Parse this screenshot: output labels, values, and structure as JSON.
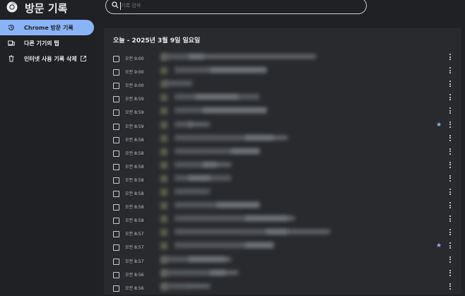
{
  "header": {
    "app_title": "방문 기록"
  },
  "search": {
    "placeholder": "기록 검색"
  },
  "sidebar": {
    "items": [
      {
        "label": "Chrome 방문 기록",
        "icon": "history-icon",
        "active": true
      },
      {
        "label": "다른 기기의 탭",
        "icon": "devices-icon",
        "active": false
      },
      {
        "label": "인터넷 사용 기록 삭제",
        "icon": "trash-icon",
        "active": false,
        "external": true
      }
    ]
  },
  "main": {
    "date_header": "오늘 - 2025년 3월 9일 일요일",
    "rows": [
      {
        "time": "오전 9:00",
        "starred": false
      },
      {
        "time": "오전 9:00",
        "starred": false
      },
      {
        "time": "오전 9:00",
        "starred": false
      },
      {
        "time": "오전 8:59",
        "starred": false
      },
      {
        "time": "오전 8:59",
        "starred": false
      },
      {
        "time": "오전 8:59",
        "starred": true
      },
      {
        "time": "오전 8:58",
        "starred": false
      },
      {
        "time": "오전 8:58",
        "starred": false
      },
      {
        "time": "오전 8:58",
        "starred": false
      },
      {
        "time": "오전 8:58",
        "starred": false
      },
      {
        "time": "오전 8:58",
        "starred": false
      },
      {
        "time": "오전 8:58",
        "starred": false
      },
      {
        "time": "오전 8:58",
        "starred": false
      },
      {
        "time": "오전 8:57",
        "starred": false
      },
      {
        "time": "오전 8:57",
        "starred": true
      },
      {
        "time": "오전 8:57",
        "starred": false
      },
      {
        "time": "오전 8:56",
        "starred": false
      },
      {
        "time": "오전 8:56",
        "starred": false
      }
    ]
  },
  "colors": {
    "accent": "#8ab4f8",
    "background": "#202124",
    "card": "#292a2d",
    "text": "#e8eaed"
  }
}
